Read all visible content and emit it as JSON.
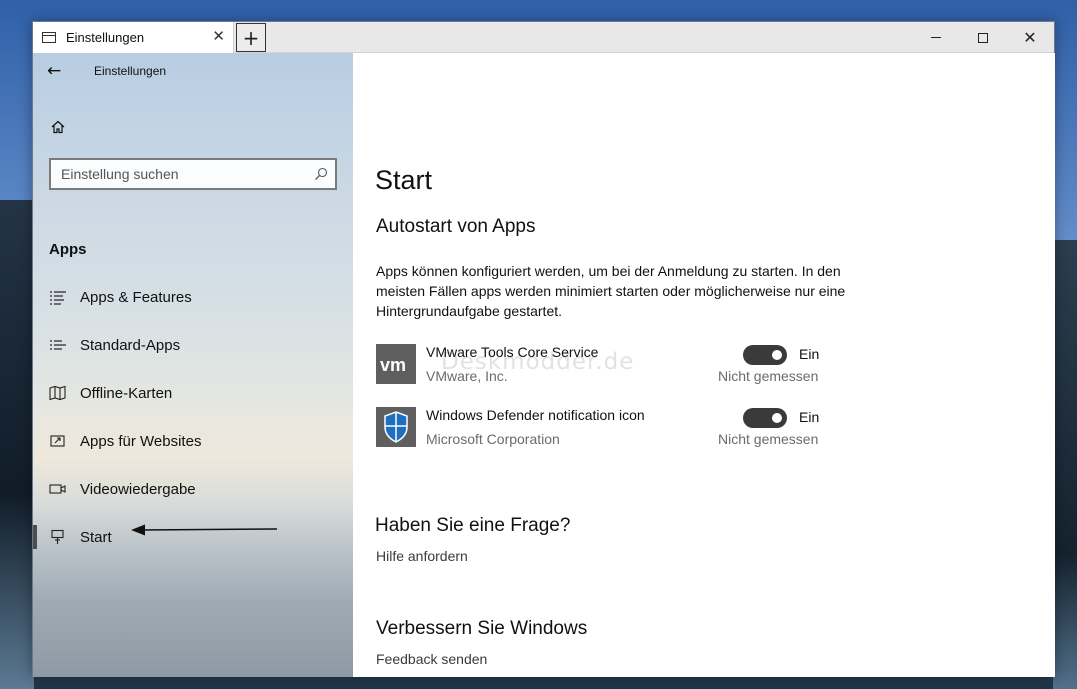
{
  "window": {
    "tab_title": "Einstellungen",
    "close_tab_glyph": "✕",
    "new_tab_glyph": "+",
    "close_glyph": "✕"
  },
  "sidebar": {
    "back_glyph": "←",
    "title": "Einstellungen",
    "search_placeholder": "Einstellung suchen",
    "section": "Apps",
    "items": [
      {
        "label": "Apps & Features",
        "icon": "list-icon"
      },
      {
        "label": "Standard-Apps",
        "icon": "default-apps-icon"
      },
      {
        "label": "Offline-Karten",
        "icon": "map-icon"
      },
      {
        "label": "Apps für Websites",
        "icon": "open-in-app-icon"
      },
      {
        "label": "Videowiedergabe",
        "icon": "video-icon"
      },
      {
        "label": "Start",
        "icon": "startup-icon",
        "active": true
      }
    ]
  },
  "content": {
    "title": "Start",
    "subtitle": "Autostart von Apps",
    "description": "Apps können konfiguriert werden, um bei der Anmeldung zu starten. In den meisten Fällen apps werden minimiert starten oder möglicherweise nur eine Hintergrundaufgabe gestartet.",
    "apps": [
      {
        "name": "VMware Tools Core Service",
        "publisher": "VMware, Inc.",
        "state": "Ein",
        "impact": "Nicht gemessen",
        "on": true,
        "icon": "vmware-icon"
      },
      {
        "name": "Windows Defender notification icon",
        "publisher": "Microsoft Corporation",
        "state": "Ein",
        "impact": "Nicht gemessen",
        "on": true,
        "icon": "defender-shield-icon"
      }
    ],
    "question_title": "Haben Sie eine Frage?",
    "help_link": "Hilfe anfordern",
    "improve_title": "Verbessern Sie Windows",
    "feedback_link": "Feedback senden",
    "watermark": "Deskmodder.de"
  },
  "colors": {
    "toggle_on": "#3a3a3a",
    "active_indicator": "#4d4d4d",
    "shield_blue": "#1f6fc0"
  }
}
